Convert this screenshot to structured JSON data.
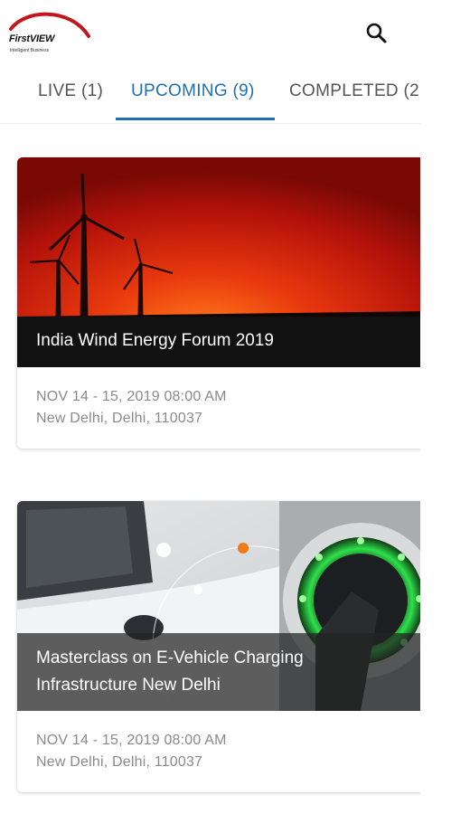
{
  "header": {
    "logo_name": "FirstVIEW",
    "logo_tagline": "Intelligent Business",
    "search_icon": "search-icon"
  },
  "tabs": [
    {
      "label": "LIVE (1)",
      "active": false
    },
    {
      "label": "UPCOMING (9)",
      "active": true
    },
    {
      "label": "COMPLETED (2",
      "active": false
    }
  ],
  "events": [
    {
      "title": "India Wind Energy Forum 2019",
      "date": "NOV 14 - 15, 2019 08:00 AM",
      "location": "New Delhi, Delhi, 110037",
      "image": "wind-turbines-sunset"
    },
    {
      "title_line1": "Masterclass on E-Vehicle Charging",
      "title_line2": "Infrastructure New Delhi",
      "date": "NOV 14 - 15, 2019 08:00 AM",
      "location": "New Delhi, Delhi, 110037",
      "image": "ev-charger"
    }
  ],
  "colors": {
    "accent": "#1e6fb8",
    "logo_red": "#c4161c",
    "tab_inactive": "#555555",
    "meta_text": "#8a8a8a"
  }
}
